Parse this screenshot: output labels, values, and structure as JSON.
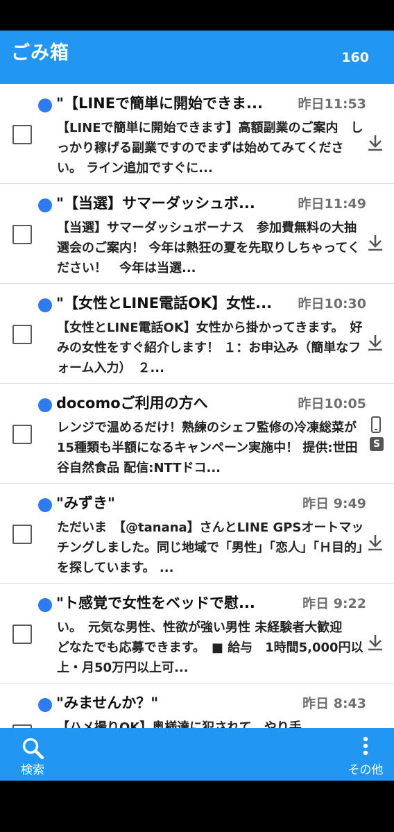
{
  "header": {
    "title": "ごみ箱",
    "count": "160"
  },
  "messages": [
    {
      "subject": "\"【LINEで簡単に開始できま...",
      "time": "昨日11:53",
      "body": "【LINEで簡単に開始できます】高額副業のご案内　しっかり稼げる副業ですのでまずは始めてみてください。 ライン追加ですぐに...",
      "side": "download"
    },
    {
      "subject": "\"【当選】サマーダッシュボ...",
      "time": "昨日11:49",
      "body": "【当選】サマーダッシュボーナス　参加費無料の大抽選会のご案内！ 今年は熱狂の夏を先取りしちゃってください！　今年は当選...",
      "side": "download"
    },
    {
      "subject": "\"【女性とLINE電話OK】女性...",
      "time": "昨日10:30",
      "body": "【女性とLINE電話OK】女性から掛かってきます。　好みの女性をすぐ紹介します！ １：お申込み（簡単なフォーム入力）　２...",
      "side": "download"
    },
    {
      "subject": "docomoご利用の方へ",
      "time": "昨日10:05",
      "body": "レンジで温めるだけ！熟練のシェフ監修の冷凍総菜が15種類も半額になるキャンペーン実施中！ 提供:世田谷自然食品 配信:NTTドコ...",
      "side": "phone-s"
    },
    {
      "subject": "\"みずき\"",
      "time": "昨日 9:49",
      "body": "ただいま　【@tanana】さんとLINE GPSオートマッチングしました。同じ地域で「男性」「恋人」「Ｈ目的」を探しています。 ...",
      "side": "download"
    },
    {
      "subject": "\"ト感覚で女性をベッドで慰...",
      "time": "昨日 9:22",
      "body": "い。　元気な男性、性欲が強い男性 未経験者大歓迎　どなたでも応募できます。　■ 給与　1時間5,000円以上・月50万円以上可...",
      "side": "download"
    },
    {
      "subject": "\"みませんか？\"",
      "time": "昨日 8:43",
      "body": "【ハメ撮りOK】奥様達に犯されて　やり手...",
      "side": "none"
    }
  ],
  "footer": {
    "search_label": "検索",
    "more_label": "その他"
  },
  "colors": {
    "primary": "#2196F3",
    "unread_dot": "#2b7cf0"
  },
  "icons": {
    "download": "download-icon",
    "phone": "phone-icon",
    "s_badge": "s-badge-icon",
    "search": "search-icon",
    "more": "more-vertical-icon"
  }
}
